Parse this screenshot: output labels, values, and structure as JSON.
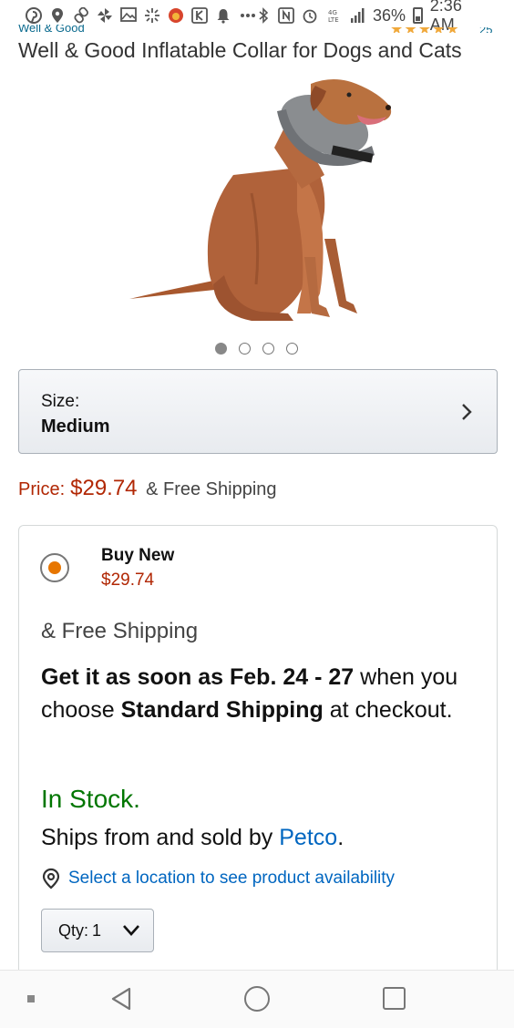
{
  "status_bar": {
    "battery_percent": "36%",
    "time": "2:36 AM",
    "icons": [
      "pinterest-icon",
      "location-icon",
      "link-icon",
      "pinwheel-icon",
      "image-icon",
      "sparkle-icon",
      "app-icon",
      "k-icon",
      "bell-icon",
      "more-icon",
      "bluetooth-icon",
      "nfc-icon",
      "alarm-icon",
      "lte-icon",
      "signal-icon",
      "battery-icon"
    ]
  },
  "header": {
    "brand_cut": "Well & Good",
    "stars_cut": "★★★★★",
    "rating_count_cut": "25",
    "title": "Well & Good Inflatable Collar for Dogs and Cats"
  },
  "gallery": {
    "image_alt": "dog wearing inflatable collar",
    "dot_count": 4,
    "active_index": 0
  },
  "size": {
    "label": "Size:",
    "value": "Medium"
  },
  "price": {
    "label": "Price:",
    "amount": "$29.74",
    "shipping": "& Free Shipping"
  },
  "offer": {
    "option_label": "Buy New",
    "option_price": "$29.74",
    "free_shipping": "& Free Shipping",
    "delivery_prefix": "Get it as soon as Feb. 24 - 27",
    "delivery_mid": " when you choose ",
    "delivery_method": "Standard Shipping",
    "delivery_suffix": " at checkout.",
    "stock": "In Stock.",
    "ships_prefix": "Ships from and sold by ",
    "seller": "Petco",
    "ships_suffix": ".",
    "location_link": "Select a location to see product availability",
    "qty_label": "Qty:",
    "qty_value": "1"
  },
  "colors": {
    "price_red": "#b12704",
    "stock_green": "#007600",
    "link_blue": "#0066c0",
    "radio_orange": "#e77600"
  }
}
